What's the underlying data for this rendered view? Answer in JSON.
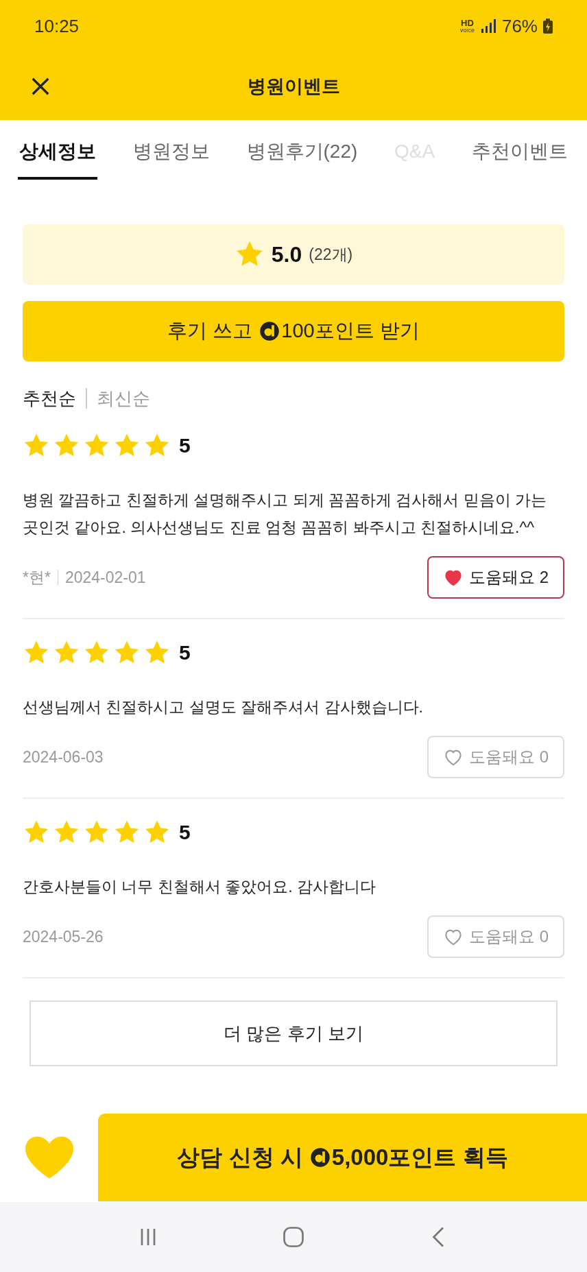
{
  "status_bar": {
    "time": "10:25",
    "hd": "HD",
    "voice": "voice",
    "battery": "76%"
  },
  "header": {
    "title": "병원이벤트"
  },
  "tabs": [
    {
      "label": "상세정보",
      "selected": true,
      "disabled": false
    },
    {
      "label": "병원정보",
      "selected": false,
      "disabled": false
    },
    {
      "label": "병원후기(22)",
      "selected": false,
      "disabled": false
    },
    {
      "label": "Q&A",
      "selected": false,
      "disabled": true
    },
    {
      "label": "추천이벤트",
      "selected": false,
      "disabled": false
    }
  ],
  "rating_summary": {
    "score": "5.0",
    "count": "(22개)"
  },
  "write_review_button": {
    "before": "후기 쓰고",
    "after": "100포인트 받기"
  },
  "sort_options": [
    {
      "label": "추천순",
      "selected": true
    },
    {
      "label": "최신순",
      "selected": false
    }
  ],
  "reviews": [
    {
      "stars": 5,
      "rating": "5",
      "text": "병원 깔끔하고 친절하게 설명해주시고 되게 꼼꼼하게 검사해서 믿음이 가는 곳인것 같아요. 의사선생님도 진료 엄청 꼼꼼히 봐주시고 친절하시네요.^^",
      "author": "*현*",
      "date": "2024-02-01",
      "helpful_label": "도움돼요",
      "helpful_count": "2",
      "liked": true
    },
    {
      "stars": 5,
      "rating": "5",
      "text": "선생님께서 친절하시고 설명도 잘해주셔서 감사했습니다.",
      "date": "2024-06-03",
      "helpful_label": "도움돼요",
      "helpful_count": "0",
      "liked": false
    },
    {
      "stars": 5,
      "rating": "5",
      "text": "간호사분들이 너무 친철해서 좋았어요. 감사합니다",
      "date": "2024-05-26",
      "helpful_label": "도움돼요",
      "helpful_count": "0",
      "liked": false
    }
  ],
  "more_reviews_button": "더 많은 후기 보기",
  "consult_button": {
    "before": "상담 신청 시",
    "after": "5,000포인트 획득"
  }
}
